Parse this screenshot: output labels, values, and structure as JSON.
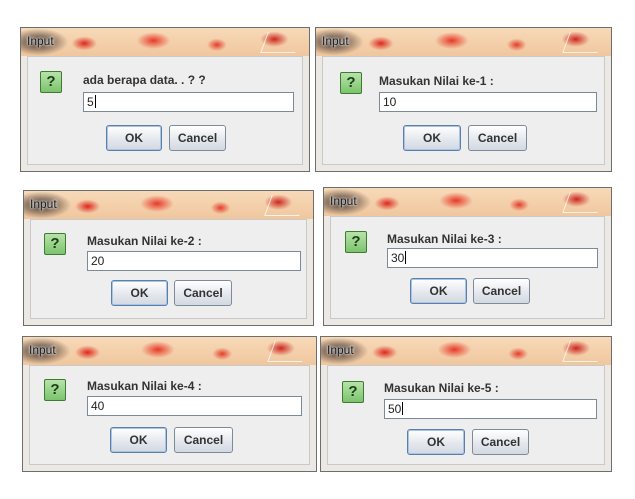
{
  "dialogs": [
    {
      "title": "Input",
      "prompt": "ada berapa data. . ? ?",
      "value": "5",
      "ok_label": "OK",
      "cancel_label": "Cancel"
    },
    {
      "title": "Input",
      "prompt": "Masukan Nilai ke-1 :",
      "value": "10",
      "ok_label": "OK",
      "cancel_label": "Cancel"
    },
    {
      "title": "Input",
      "prompt": "Masukan Nilai ke-2 :",
      "value": "20",
      "ok_label": "OK",
      "cancel_label": "Cancel"
    },
    {
      "title": "Input",
      "prompt": "Masukan Nilai ke-3 :",
      "value": "30",
      "ok_label": "OK",
      "cancel_label": "Cancel"
    },
    {
      "title": "Input",
      "prompt": "Masukan Nilai ke-4 :",
      "value": "40",
      "ok_label": "OK",
      "cancel_label": "Cancel"
    },
    {
      "title": "Input",
      "prompt": "Masukan Nilai ke-5 :",
      "value": "50",
      "ok_label": "OK",
      "cancel_label": "Cancel"
    }
  ],
  "icons": {
    "question": "question-icon"
  }
}
